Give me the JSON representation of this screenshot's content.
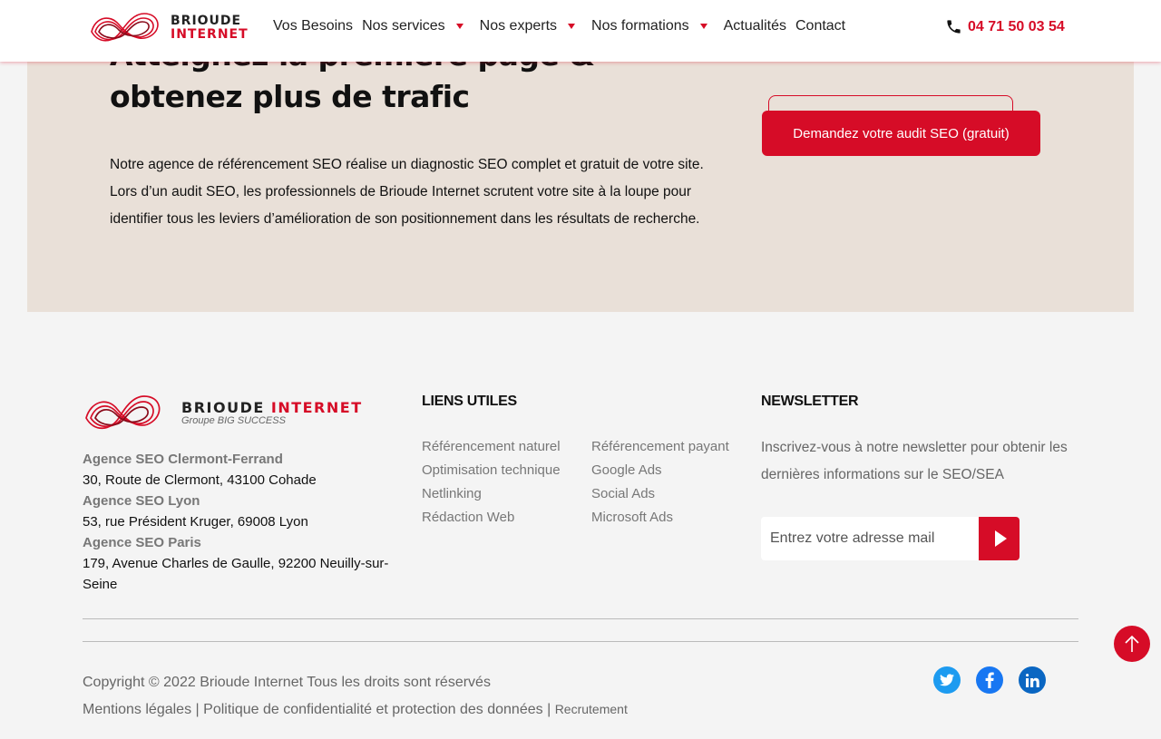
{
  "header": {
    "logo": {
      "word1": "BRIOUDE",
      "word2": "INTERNET"
    },
    "nav": [
      {
        "label": "Vos Besoins",
        "dropdown": false
      },
      {
        "label": "Nos services",
        "dropdown": true
      },
      {
        "label": "Nos experts",
        "dropdown": true
      },
      {
        "label": "Nos formations",
        "dropdown": true
      },
      {
        "label": "Actualités",
        "dropdown": false
      },
      {
        "label": "Contact",
        "dropdown": false
      }
    ],
    "phone": "04 71 50 03 54",
    "phone_icon": "phone-icon"
  },
  "hero": {
    "title": "Atteignez la première page & obtenez plus de trafic",
    "paragraph_lines": [
      "Notre agence de référencement SEO réalise un diagnostic SEO complet et gratuit de votre site.",
      "Lors d’un audit SEO, les professionnels de Brioude Internet scrutent votre site à la loupe pour",
      "identifier tous les leviers d’amélioration de son positionnement dans les résultats de recherche."
    ],
    "cta_label": "Demandez votre audit SEO (gratuit)"
  },
  "footer": {
    "logo": {
      "word1": "BRIOUDE",
      "word2": "INTERNET",
      "tagline": "Groupe BIG SUCCESS"
    },
    "agencies": [
      {
        "city": "Agence SEO Clermont-Ferrand",
        "address": "30, Route de Clermont, 43100 Cohade"
      },
      {
        "city": "Agence SEO Lyon",
        "address": "53, rue Président Kruger, 69008 Lyon"
      },
      {
        "city": "Agence SEO Paris",
        "address": "179, Avenue Charles de Gaulle, 92200 Neuilly-sur-Seine"
      }
    ],
    "useful_links_title": "LIENS UTILES",
    "links_col1": [
      "Référencement naturel",
      "Optimisation technique",
      "Netlinking",
      "Rédaction Web"
    ],
    "links_col2": [
      "Référencement payant",
      "Google Ads",
      "Social Ads",
      "Microsoft Ads"
    ],
    "newsletter_title": "NEWSLETTER",
    "newsletter_text": "Inscrivez-vous à notre newsletter pour obtenir les dernières informations sur le SEO/SEA",
    "newsletter_placeholder": "Entrez votre adresse mail",
    "copyright": "Copyright © 2022 Brioude Internet Tous les droits sont réservés",
    "legal_links": [
      "Mentions légales",
      "Politique de confidentialité et protection des données",
      "Recrutement"
    ],
    "separator": "|",
    "social_icons": [
      "twitter-icon",
      "facebook-icon",
      "linkedin-icon"
    ]
  },
  "colors": {
    "brand_red": "#d60c27",
    "hero_bg": "#e9e0d8",
    "page_bg": "#f4f4f4"
  }
}
